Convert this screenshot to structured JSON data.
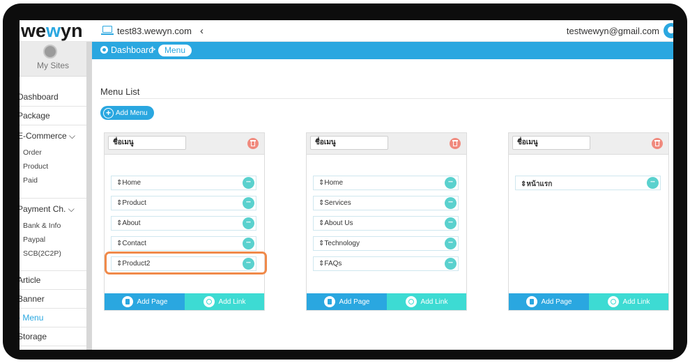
{
  "header": {
    "logo": {
      "left": "we",
      "mid": "w",
      "right": "yn"
    },
    "site": "test83.wewyn.com",
    "collapse_glyph": "‹",
    "user_email": "testwewyn@gmail.com"
  },
  "sidebar": {
    "my_sites": "My Sites",
    "items": {
      "dashboard": "Dashboard",
      "package": "Package",
      "ecommerce": "E-Commerce ⌵",
      "order": "Order",
      "product": "Product",
      "paid": "Paid",
      "payment": "Payment Ch. ⌵",
      "bank": "Bank & Info",
      "paypal": "Paypal",
      "scb": "SCB(2C2P)",
      "article": "Article",
      "banner": "Banner",
      "menu": "Menu",
      "storage": "Storage"
    }
  },
  "breadcrumb": {
    "home": "Dashboard",
    "sep": ">",
    "current": "Menu"
  },
  "main": {
    "title": "Menu List",
    "add_menu": "Add Menu"
  },
  "cards": [
    {
      "name": "ชื่อเมนู",
      "items": [
        "Home",
        "Product",
        "About",
        "Contact",
        "Product2"
      ],
      "add_page": "Add Page",
      "add_link": "Add Link"
    },
    {
      "name": "ชื่อเมนู",
      "items": [
        "Home",
        "Services",
        "About Us",
        "Technology",
        "FAQs"
      ],
      "add_page": "Add Page",
      "add_link": "Add Link"
    },
    {
      "name": "ชื่อเมนู",
      "items": [
        "หน้าแรก"
      ],
      "add_page": "Add Page",
      "add_link": "Add Link"
    }
  ],
  "item_prefix": "⇕",
  "colors": {
    "primary": "#2aa7e0",
    "teal": "#3ddbd3",
    "danger": "#f08a7e",
    "highlight": "#f08a4a"
  }
}
